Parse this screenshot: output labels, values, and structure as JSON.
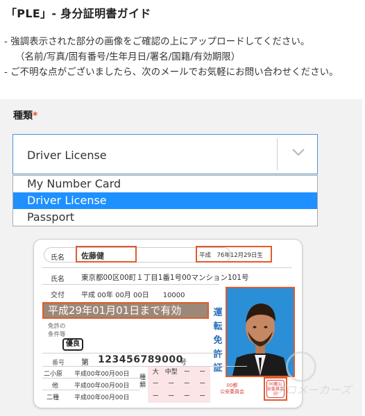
{
  "title": "「PLE」- 身分証明書ガイド",
  "notes": {
    "line1": "- 強調表示された部分の画像をご確認の上にアップロードしてください。",
    "line2": "（名前/写真/固有番号/生年月日/署名/国籍/有効期限）",
    "line3": "- ご不明な点がございましたら、次のメールでお気軽にお問い合わせください。"
  },
  "form": {
    "label": "種類",
    "required_mark": "*",
    "selected_value": "Driver License",
    "options": [
      "My Number Card",
      "Driver License",
      "Passport"
    ]
  },
  "card": {
    "name_label": "氏名",
    "name_value": "佐藤健",
    "dob": "平成　76年12月29日生",
    "address_label": "氏名",
    "address_value": "東京都00区00町１丁目1番1号00マンション101号",
    "issue_label": "交付",
    "issue_value": "平成 00年 00月 00日　　10000",
    "expiry": "平成29年01月01日まで有効",
    "conditions_label1": "免許の",
    "conditions_label2": "条件等",
    "badge": "優良",
    "vertical_text": "運転免許証",
    "number_label": "番号",
    "number_prefix": "第",
    "number_value": "123456789000",
    "number_suffix": "号",
    "class_rows": [
      {
        "label": "二小原",
        "value": "平成00年00月00日"
      },
      {
        "label": "他",
        "value": "平成00年00月00日"
      },
      {
        "label": "二種",
        "value": "平成00年00月00日"
      }
    ],
    "type_label": "種類",
    "grid_chars": [
      "大",
      "中型",
      "ー",
      "ー",
      "ー",
      "ー",
      "ー",
      "ー",
      "ー",
      "ー",
      "ー",
      "ー"
    ],
    "authority_left": "00都\n公安委員会",
    "seal_text": "00都公安委員会印"
  },
  "watermark": "プロメーカーズ",
  "colors": {
    "accent_red": "#e35a2b",
    "select_blue": "#1e90ff",
    "photo_bg": "#2a8fd6",
    "vertical_blue": "#2a6fb8"
  }
}
